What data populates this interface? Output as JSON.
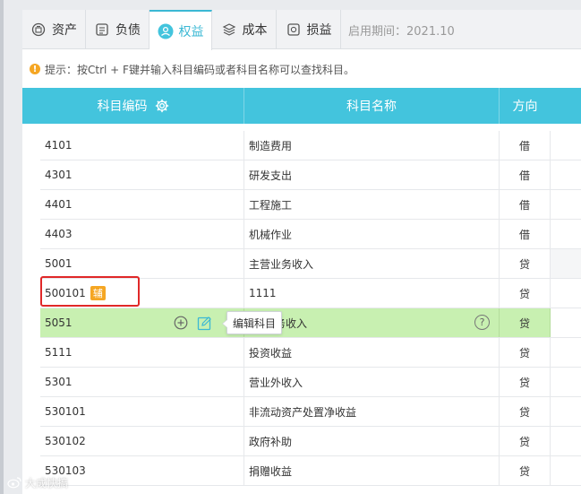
{
  "tabs": [
    {
      "label": "资产",
      "icon": "asset-icon"
    },
    {
      "label": "负债",
      "icon": "liability-icon"
    },
    {
      "label": "权益",
      "icon": "equity-icon",
      "active": true
    },
    {
      "label": "成本",
      "icon": "cost-layers-icon"
    },
    {
      "label": "损益",
      "icon": "profit-loss-icon"
    }
  ],
  "period_label": "启用期间：2021.10",
  "hint_text": "提示：按Ctrl + F键并输入科目编码或者科目名称可以查找科目。",
  "table": {
    "headers": {
      "code": "科目编码",
      "name": "科目名称",
      "direction": "方向"
    },
    "rows": [
      {
        "code": "4101",
        "name": "制造费用",
        "direction": "借"
      },
      {
        "code": "4301",
        "name": "研发支出",
        "direction": "借"
      },
      {
        "code": "4401",
        "name": "工程施工",
        "direction": "借"
      },
      {
        "code": "4403",
        "name": "机械作业",
        "direction": "借"
      },
      {
        "code": "5001",
        "name": "主营业务收入",
        "direction": "贷"
      },
      {
        "code": "500101",
        "name": "1111",
        "direction": "贷",
        "badge": "辅"
      },
      {
        "code": "5051",
        "name": "务收入",
        "direction": "贷"
      },
      {
        "code": "5111",
        "name": "投资收益",
        "direction": "贷"
      },
      {
        "code": "5301",
        "name": "营业外收入",
        "direction": "贷"
      },
      {
        "code": "530101",
        "name": "非流动资产处置净收益",
        "direction": "贷"
      },
      {
        "code": "530102",
        "name": "政府补助",
        "direction": "贷"
      },
      {
        "code": "530103",
        "name": "捐赠收益",
        "direction": "贷"
      }
    ]
  },
  "row_tooltip": "编辑科目",
  "help_symbol": "?",
  "watermark": "大成快搞",
  "colors": {
    "accent": "#43c4dd",
    "highlight_row": "#c8f0b1",
    "badge": "#f5a623",
    "red_box": "#e02828"
  }
}
